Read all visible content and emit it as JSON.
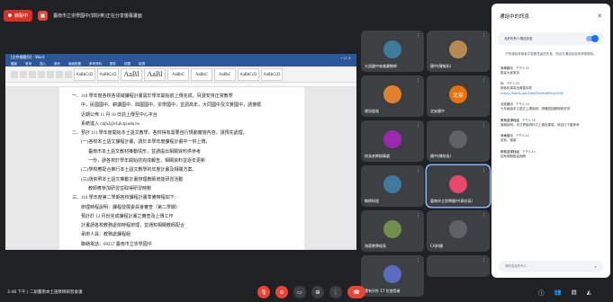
{
  "topbar": {
    "rec_label": "錄製中",
    "presenter": "臺南市立崇學國中(郭妙英)正在分享螢幕畫面"
  },
  "word": {
    "window_title": "[文件標題列] - Word",
    "menu": [
      "檔案",
      "常用",
      "插入",
      "設計",
      "版面配置",
      "參考資料",
      "郵件",
      "校閱",
      "檢視"
    ],
    "styles": [
      "AaBbCcD",
      "AaBbCcD",
      "AaBl",
      "AaBl",
      "AaBbC",
      "AaBbC",
      "AaBbC",
      "AaBbCcD",
      "AaBbCcD"
    ],
    "lines": [
      "一、110 學年度各校各領域課程計畫需於學年開始前上傳完成，另請安排正常教學",
      "中，民國國中、耕讀國中、興國國中，崇學國中，並調高年，大同國中及文賢國中，請遵循",
      "近期公佈 11 月 10 日前上傳至中心平台",
      "系統進入 chjh2@chjh.tp.edu.tw",
      "二、預計 111 學年度開始本土語文教學，各校得有需要自行規劃實施內容，請預先處理。",
      "(一)各校本土語文課程計畫，請於本學年度課程計畫中一併上傳，",
      "臺南市本土語文教材推動情形，並請提出相關資料供參考",
      "一份，請各校於學年開始前完成報告，相關資料並逐年更新",
      "(二)學校應配合推行本土語文教學的年度計畫及相關方案。",
      "(三)請依照本土語文推動計畫辦理教師增能研習活動",
      "教師應參加研習並取得研習時數",
      "三、110 學年度第二學期各校課程計畫準備時程如下：",
      "辦理時程說明：課程發展委員會審查（第二學期）",
      "預計於 12 月份完成課程計畫之審查及上傳工作",
      "計畫請各校教務處依時程辦理，並通知相關教師配合",
      "承辦人員：教務處課程組",
      "聯絡電話：09257 臺南市立崇學國中"
    ]
  },
  "participants": [
    {
      "name": "大昌國中林美蘭教師",
      "initial": "",
      "color": "#3d7a9c"
    },
    {
      "name": "國中(陳郁如)",
      "initial": "",
      "color": "#b9894f"
    },
    {
      "name": "資訊組長",
      "initial": "",
      "color": "#e0812f"
    },
    {
      "name": "北安國中",
      "initial": "北安",
      "color": "#e8710a"
    },
    {
      "name": "校長老師辦事處",
      "initial": "",
      "color": "#9c27b0"
    },
    {
      "name": "國中(陳校長)",
      "initial": "",
      "color": "#5f6368"
    },
    {
      "name": "教師研習",
      "initial": "",
      "color": "#3d7a9c"
    },
    {
      "name": "臺南市立崇學國中(郭妙英)",
      "initial": "",
      "color": "#e8476b"
    },
    {
      "name": "海東教學組長",
      "initial": "",
      "color": "#6f8f4a"
    },
    {
      "name": "CHJH國",
      "initial": "",
      "color": "#5f6368"
    },
    {
      "name": "還有另外 17 位使用者",
      "initial": "",
      "color": "#5c6bc0"
    },
    {
      "name": "",
      "initial": "",
      "color": "#3c4043"
    }
  ],
  "chat": {
    "title": "通話中的訊息",
    "toggle_label": "允許所有人傳送訊息",
    "info": "只有通話參與者才能看見這些訊息，而且在通話結束後會被刪除。",
    "messages": [
      {
        "sender": "崇學國中",
        "time": "下午2:30",
        "text": "歡迎大家參加"
      },
      {
        "sender": "你",
        "time": "下午2:32",
        "text": "請各校填寫出席簽到表",
        "link": "https://forms.gle/ZMdCEKhfrWPbQ00O6"
      },
      {
        "sender": "北安國中",
        "time": "下午2:34",
        "text": "七年級組本土語文上課說明，請確認相關時數安排"
      },
      {
        "sender": "教務處課程組",
        "time": "下午2:38",
        "text": "謝謝說明。本日會議資料已上傳至雲端，請自行下載參考"
      },
      {
        "sender": "海東國中",
        "time": "下午2:42",
        "text": "收到，謝謝"
      },
      {
        "sender": "教務處課程組",
        "time": "下午2:44",
        "text": "如有問題歡迎詢問"
      }
    ],
    "input_placeholder": "傳訊息給所有人"
  },
  "bottombar": {
    "time": "3:48 下午",
    "meeting": "二創臺南本土語教師研習會議"
  },
  "colors": {
    "accent": "#1a73e8",
    "danger": "#ea4335",
    "surface": "#3c4043",
    "background": "#202124"
  }
}
